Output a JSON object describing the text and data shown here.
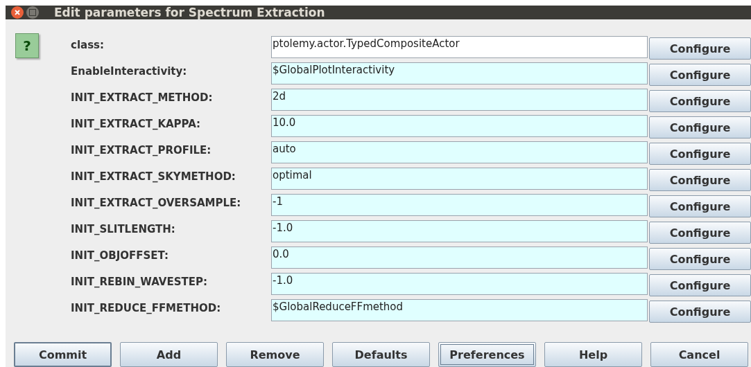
{
  "window": {
    "title": "Edit parameters for Spectrum Extraction"
  },
  "parameters": [
    {
      "label": "class:",
      "value": "ptolemy.actor.TypedCompositeActor",
      "kind": "plain",
      "button": "Configure"
    },
    {
      "label": "EnableInteractivity:",
      "value": "$GlobalPlotInteractivity",
      "kind": "expression",
      "button": "Configure"
    },
    {
      "label": "INIT_EXTRACT_METHOD:",
      "value": "2d",
      "kind": "expression",
      "button": "Configure"
    },
    {
      "label": "INIT_EXTRACT_KAPPA:",
      "value": "10.0",
      "kind": "expression",
      "button": "Configure"
    },
    {
      "label": "INIT_EXTRACT_PROFILE:",
      "value": "auto",
      "kind": "expression",
      "button": "Configure"
    },
    {
      "label": "INIT_EXTRACT_SKYMETHOD:",
      "value": "optimal",
      "kind": "expression",
      "button": "Configure"
    },
    {
      "label": "INIT_EXTRACT_OVERSAMPLE:",
      "value": "-1",
      "kind": "expression",
      "button": "Configure"
    },
    {
      "label": "INIT_SLITLENGTH:",
      "value": "-1.0",
      "kind": "expression",
      "button": "Configure"
    },
    {
      "label": "INIT_OBJOFFSET:",
      "value": "0.0",
      "kind": "expression",
      "button": "Configure"
    },
    {
      "label": "INIT_REBIN_WAVESTEP:",
      "value": "-1.0",
      "kind": "expression",
      "button": "Configure"
    },
    {
      "label": "INIT_REDUCE_FFMETHOD:",
      "value": "$GlobalReduceFFmethod",
      "kind": "expression",
      "button": "Configure"
    }
  ],
  "help_icon": {
    "label": "?"
  },
  "buttons": [
    {
      "label": "Commit",
      "default": true,
      "focused": false
    },
    {
      "label": "Add",
      "default": false,
      "focused": false
    },
    {
      "label": "Remove",
      "default": false,
      "focused": false
    },
    {
      "label": "Defaults",
      "default": false,
      "focused": false
    },
    {
      "label": "Preferences",
      "default": false,
      "focused": true
    },
    {
      "label": "Help",
      "default": false,
      "focused": false
    },
    {
      "label": "Cancel",
      "default": false,
      "focused": false
    }
  ]
}
